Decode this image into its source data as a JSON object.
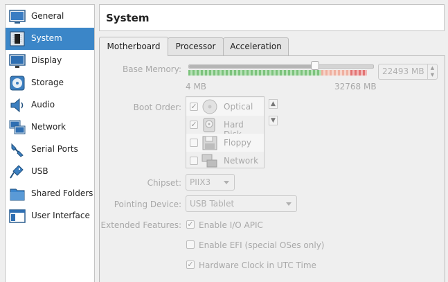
{
  "sidebar": {
    "items": [
      {
        "label": "General",
        "icon": "general-icon"
      },
      {
        "label": "System",
        "icon": "system-chip-icon"
      },
      {
        "label": "Display",
        "icon": "display-monitor-icon"
      },
      {
        "label": "Storage",
        "icon": "storage-disc-icon"
      },
      {
        "label": "Audio",
        "icon": "speaker-icon"
      },
      {
        "label": "Network",
        "icon": "network-icon"
      },
      {
        "label": "Serial Ports",
        "icon": "serial-port-icon"
      },
      {
        "label": "USB",
        "icon": "usb-icon"
      },
      {
        "label": "Shared Folders",
        "icon": "shared-folder-icon"
      },
      {
        "label": "User Interface",
        "icon": "user-interface-icon"
      }
    ],
    "active_index": 1
  },
  "header": {
    "title": "System"
  },
  "tabs": [
    {
      "label": "Motherboard",
      "active": true
    },
    {
      "label": "Processor",
      "active": false
    },
    {
      "label": "Acceleration",
      "active": false
    }
  ],
  "motherboard": {
    "base_memory": {
      "label": "Base Memory:",
      "min_label": "4 MB",
      "max_label": "32768 MB",
      "min_mb": 4,
      "max_mb": 32768,
      "value_mb": 22493,
      "value_text": "22493 MB"
    },
    "boot_order": {
      "label": "Boot Order:",
      "items": [
        {
          "label": "Optical",
          "checked": true,
          "icon": "optical-disc-icon"
        },
        {
          "label": "Hard Disk",
          "checked": true,
          "icon": "hard-disk-icon"
        },
        {
          "label": "Floppy",
          "checked": false,
          "icon": "floppy-icon"
        },
        {
          "label": "Network",
          "checked": false,
          "icon": "network-boot-icon"
        }
      ]
    },
    "chipset": {
      "label": "Chipset:",
      "value": "PIIX3"
    },
    "pointing_device": {
      "label": "Pointing Device:",
      "value": "USB Tablet"
    },
    "extended_features": {
      "label": "Extended Features:",
      "items": [
        {
          "label": "Enable I/O APIC",
          "checked": true
        },
        {
          "label": "Enable EFI (special OSes only)",
          "checked": false
        },
        {
          "label": "Hardware Clock in UTC Time",
          "checked": true
        }
      ]
    }
  },
  "colors": {
    "accent": "#3b86c8",
    "disabled_text": "#a8a8a8"
  }
}
